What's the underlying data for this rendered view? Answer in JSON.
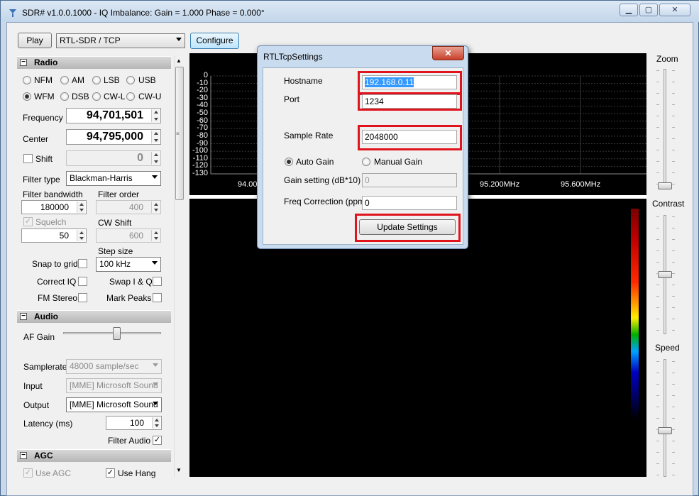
{
  "window": {
    "title": "SDR# v1.0.0.1000 - IQ Imbalance: Gain = 1.000 Phase = 0.000°",
    "caption_buttons": [
      "minimize-icon",
      "maximize-icon",
      "close-icon"
    ]
  },
  "toolbar": {
    "play_label": "Play",
    "source": "RTL-SDR / TCP",
    "configure_label": "Configure"
  },
  "radio": {
    "section_label": "Radio",
    "modes": [
      {
        "label": "NFM",
        "checked": false
      },
      {
        "label": "AM",
        "checked": false
      },
      {
        "label": "LSB",
        "checked": false
      },
      {
        "label": "USB",
        "checked": false
      },
      {
        "label": "WFM",
        "checked": true
      },
      {
        "label": "DSB",
        "checked": false
      },
      {
        "label": "CW-L",
        "checked": false
      },
      {
        "label": "CW-U",
        "checked": false
      }
    ],
    "frequency_label": "Frequency",
    "frequency_value": "94,701,501",
    "center_label": "Center",
    "center_value": "94,795,000",
    "shift_label": "Shift",
    "shift_value": "0",
    "filter_type_label": "Filter type",
    "filter_type_value": "Blackman-Harris",
    "filter_bandwidth_label": "Filter bandwidth",
    "filter_bandwidth_value": "180000",
    "filter_order_label": "Filter order",
    "filter_order_value": "400",
    "squelch_label": "Squelch",
    "squelch_value": "50",
    "cw_shift_label": "CW Shift",
    "cw_shift_value": "600",
    "step_size_label": "Step size",
    "step_size_value": "100 kHz",
    "snap_to_grid_label": "Snap to grid",
    "correct_iq_label": "Correct IQ",
    "swap_iq_label": "Swap I & Q",
    "fm_stereo_label": "FM Stereo",
    "mark_peaks_label": "Mark Peaks"
  },
  "audio": {
    "section_label": "Audio",
    "af_gain_label": "AF Gain",
    "af_gain_level": 0.55,
    "samplerate_label": "Samplerate",
    "samplerate_value": "48000 sample/sec",
    "input_label": "Input",
    "input_value": "[MME] Microsoft Sound",
    "output_label": "Output",
    "output_value": "[MME] Microsoft Sound",
    "latency_label": "Latency (ms)",
    "latency_value": "100",
    "filter_audio_label": "Filter Audio"
  },
  "agc": {
    "section_label": "AGC",
    "use_agc_label": "Use AGC",
    "use_hang_label": "Use Hang"
  },
  "spectrum": {
    "y_ticks": [
      "0",
      "-10",
      "-20",
      "-30",
      "-40",
      "-50",
      "-60",
      "-70",
      "-80",
      "-90",
      "-100",
      "-110",
      "-120",
      "-130"
    ],
    "x_ticks": [
      "94.00",
      "95.200MHz",
      "95.600MHz"
    ]
  },
  "side_controls": {
    "zoom_label": "Zoom",
    "contrast_label": "Contrast",
    "speed_label": "Speed"
  },
  "dialog": {
    "title": "RTLTcpSettings",
    "hostname_label": "Hostname",
    "hostname_value": "192.168.0.11",
    "port_label": "Port",
    "port_value": "1234",
    "sample_rate_label": "Sample Rate",
    "sample_rate_value": "2048000",
    "auto_gain_label": "Auto Gain",
    "manual_gain_label": "Manual Gain",
    "gain_setting_label": "Gain setting (dB*10)",
    "gain_setting_value": "0",
    "freq_correction_label": "Freq Correction (ppm)",
    "freq_correction_value": "0",
    "update_label": "Update Settings"
  }
}
